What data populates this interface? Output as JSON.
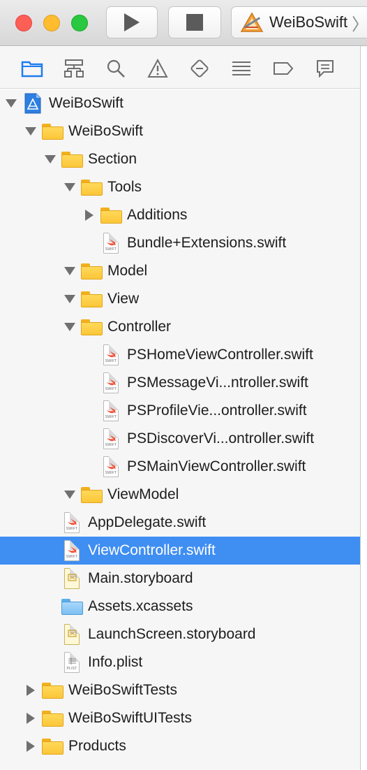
{
  "window": {
    "toolbar": {
      "run_icon": "play-icon",
      "stop_icon": "stop-icon",
      "scheme_icon": "xcode-app-icon",
      "scheme_label": "WeiBoSwift",
      "scheme_chevron": "〉"
    }
  },
  "navigator_tabs": [
    {
      "name": "project-navigator",
      "icon": "folder-icon",
      "active": true
    },
    {
      "name": "symbol-navigator",
      "icon": "hierarchy-icon",
      "active": false
    },
    {
      "name": "find-navigator",
      "icon": "magnifier-icon",
      "active": false
    },
    {
      "name": "issue-navigator",
      "icon": "warning-icon",
      "active": false
    },
    {
      "name": "test-navigator",
      "icon": "diamond-minus-icon",
      "active": false
    },
    {
      "name": "debug-navigator",
      "icon": "list-icon",
      "active": false
    },
    {
      "name": "breakpoint-navigator",
      "icon": "tag-icon",
      "active": false
    },
    {
      "name": "report-navigator",
      "icon": "speech-bubble-icon",
      "active": false
    }
  ],
  "tree": [
    {
      "label": "WeiBoSwift",
      "depth": 0,
      "disclosure": "open",
      "icon": "project"
    },
    {
      "label": "WeiBoSwift",
      "depth": 1,
      "disclosure": "open",
      "icon": "folder"
    },
    {
      "label": "Section",
      "depth": 2,
      "disclosure": "open",
      "icon": "folder"
    },
    {
      "label": "Tools",
      "depth": 3,
      "disclosure": "open",
      "icon": "folder"
    },
    {
      "label": "Additions",
      "depth": 4,
      "disclosure": "closed",
      "icon": "folder"
    },
    {
      "label": "Bundle+Extensions.swift",
      "depth": 4,
      "disclosure": "none",
      "icon": "swift"
    },
    {
      "label": "Model",
      "depth": 3,
      "disclosure": "open",
      "icon": "folder"
    },
    {
      "label": "View",
      "depth": 3,
      "disclosure": "open",
      "icon": "folder"
    },
    {
      "label": "Controller",
      "depth": 3,
      "disclosure": "open",
      "icon": "folder"
    },
    {
      "label": "PSHomeViewController.swift",
      "depth": 4,
      "disclosure": "none",
      "icon": "swift"
    },
    {
      "label": "PSMessageVi...ntroller.swift",
      "depth": 4,
      "disclosure": "none",
      "icon": "swift"
    },
    {
      "label": "PSProfileVie...ontroller.swift",
      "depth": 4,
      "disclosure": "none",
      "icon": "swift"
    },
    {
      "label": "PSDiscoverVi...ontroller.swift",
      "depth": 4,
      "disclosure": "none",
      "icon": "swift"
    },
    {
      "label": "PSMainViewController.swift",
      "depth": 4,
      "disclosure": "none",
      "icon": "swift"
    },
    {
      "label": "ViewModel",
      "depth": 3,
      "disclosure": "open",
      "icon": "folder"
    },
    {
      "label": "AppDelegate.swift",
      "depth": 2,
      "disclosure": "none",
      "icon": "swift"
    },
    {
      "label": "ViewController.swift",
      "depth": 2,
      "disclosure": "none",
      "icon": "swift",
      "selected": true
    },
    {
      "label": "Main.storyboard",
      "depth": 2,
      "disclosure": "none",
      "icon": "storyboard"
    },
    {
      "label": "Assets.xcassets",
      "depth": 2,
      "disclosure": "none",
      "icon": "assets"
    },
    {
      "label": "LaunchScreen.storyboard",
      "depth": 2,
      "disclosure": "none",
      "icon": "storyboard"
    },
    {
      "label": "Info.plist",
      "depth": 2,
      "disclosure": "none",
      "icon": "plist"
    },
    {
      "label": "WeiBoSwiftTests",
      "depth": 1,
      "disclosure": "closed",
      "icon": "folder"
    },
    {
      "label": "WeiBoSwiftUITests",
      "depth": 1,
      "disclosure": "closed",
      "icon": "folder"
    },
    {
      "label": "Products",
      "depth": 1,
      "disclosure": "closed",
      "icon": "folder"
    }
  ],
  "icon_captions": {
    "swift": "SWIFT",
    "plist": "PLIST"
  },
  "colors": {
    "selection": "#3f8ef2",
    "nav_active": "#1f7cf0",
    "nav_inactive": "#6e6e6e",
    "folder": "#fbc638",
    "swift": "#f05138"
  }
}
